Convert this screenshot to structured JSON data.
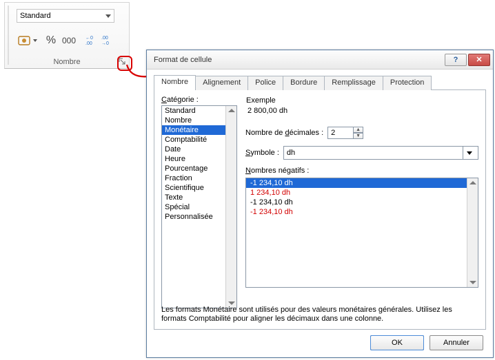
{
  "ribbon": {
    "format_dropdown_value": "Standard",
    "group_label": "Nombre"
  },
  "dialog": {
    "title": "Format de cellule",
    "tabs": [
      "Nombre",
      "Alignement",
      "Police",
      "Bordure",
      "Remplissage",
      "Protection"
    ],
    "active_tab_index": 0,
    "category_label": "Catégorie :",
    "categories": [
      "Standard",
      "Nombre",
      "Monétaire",
      "Comptabilité",
      "Date",
      "Heure",
      "Pourcentage",
      "Fraction",
      "Scientifique",
      "Texte",
      "Spécial",
      "Personnalisée"
    ],
    "selected_category_index": 2,
    "example_label": "Exemple",
    "example_value": "2 800,00 dh",
    "decimals_label": "Nombre de décimales :",
    "decimals_value": "2",
    "symbol_label": "Symbole :",
    "symbol_value": "dh",
    "negatives_label": "Nombres négatifs :",
    "negatives": [
      {
        "text": "-1 234,10 dh",
        "red": false,
        "selected": true
      },
      {
        "text": "1 234,10 dh",
        "red": true,
        "selected": false
      },
      {
        "text": "-1 234,10 dh",
        "red": false,
        "selected": false
      },
      {
        "text": "-1 234,10 dh",
        "red": true,
        "selected": false
      }
    ],
    "hint": "Les formats Monétaire sont utilisés pour des valeurs monétaires générales. Utilisez les formats Comptabilité pour aligner les décimaux dans une colonne.",
    "ok_label": "OK",
    "cancel_label": "Annuler"
  }
}
